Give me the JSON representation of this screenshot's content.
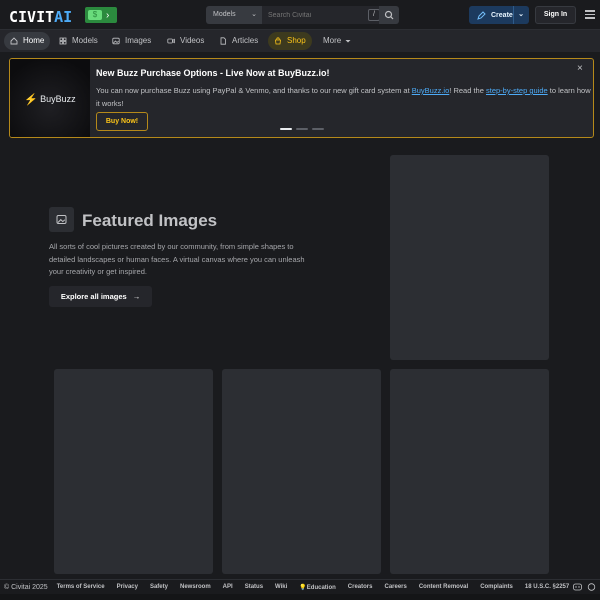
{
  "header": {
    "logo_main": "CIVIT",
    "logo_ai": "AI",
    "search": {
      "model_select": "Models",
      "placeholder": "Search Civitai",
      "shortcut": "/"
    },
    "create_label": "Create",
    "signin_label": "Sign In"
  },
  "nav": {
    "items": [
      {
        "label": "Home",
        "icon": "home-icon"
      },
      {
        "label": "Models",
        "icon": "grid-icon"
      },
      {
        "label": "Images",
        "icon": "image-icon"
      },
      {
        "label": "Videos",
        "icon": "video-icon"
      },
      {
        "label": "Articles",
        "icon": "article-icon"
      },
      {
        "label": "Shop",
        "icon": "shop-icon"
      },
      {
        "label": "More",
        "icon": "chevron-down-icon"
      }
    ]
  },
  "banner": {
    "image_label": "BuyBuzz",
    "title": "New Buzz Purchase Options - Live Now at BuyBuzz.io!",
    "body_part1": "You can now purchase Buzz using PayPal & Venmo, and thanks to our new gift card system at ",
    "link1": "BuyBuzz.io",
    "body_part2": "! Read the ",
    "link2": "step-by-step guide",
    "body_part3": " to learn how it works!",
    "button": "Buy Now!",
    "close": "×",
    "accent": "#b5891a"
  },
  "featured": {
    "title": "Featured Images",
    "description": "All sorts of cool pictures created by our community, from simple shapes to detailed landscapes or human faces. A virtual canvas where you can unleash your creativity or get inspired.",
    "explore_label": "Explore all images",
    "explore_arrow": "→"
  },
  "footer": {
    "copyright": "© Civitai 2025",
    "links": [
      "Terms of Service",
      "Privacy",
      "Safety",
      "Newsroom",
      "API",
      "Status",
      "Wiki",
      "💡Education",
      "Creators",
      "Careers",
      "Content Removal",
      "Complaints",
      "18 U.S.C. §2257"
    ]
  }
}
